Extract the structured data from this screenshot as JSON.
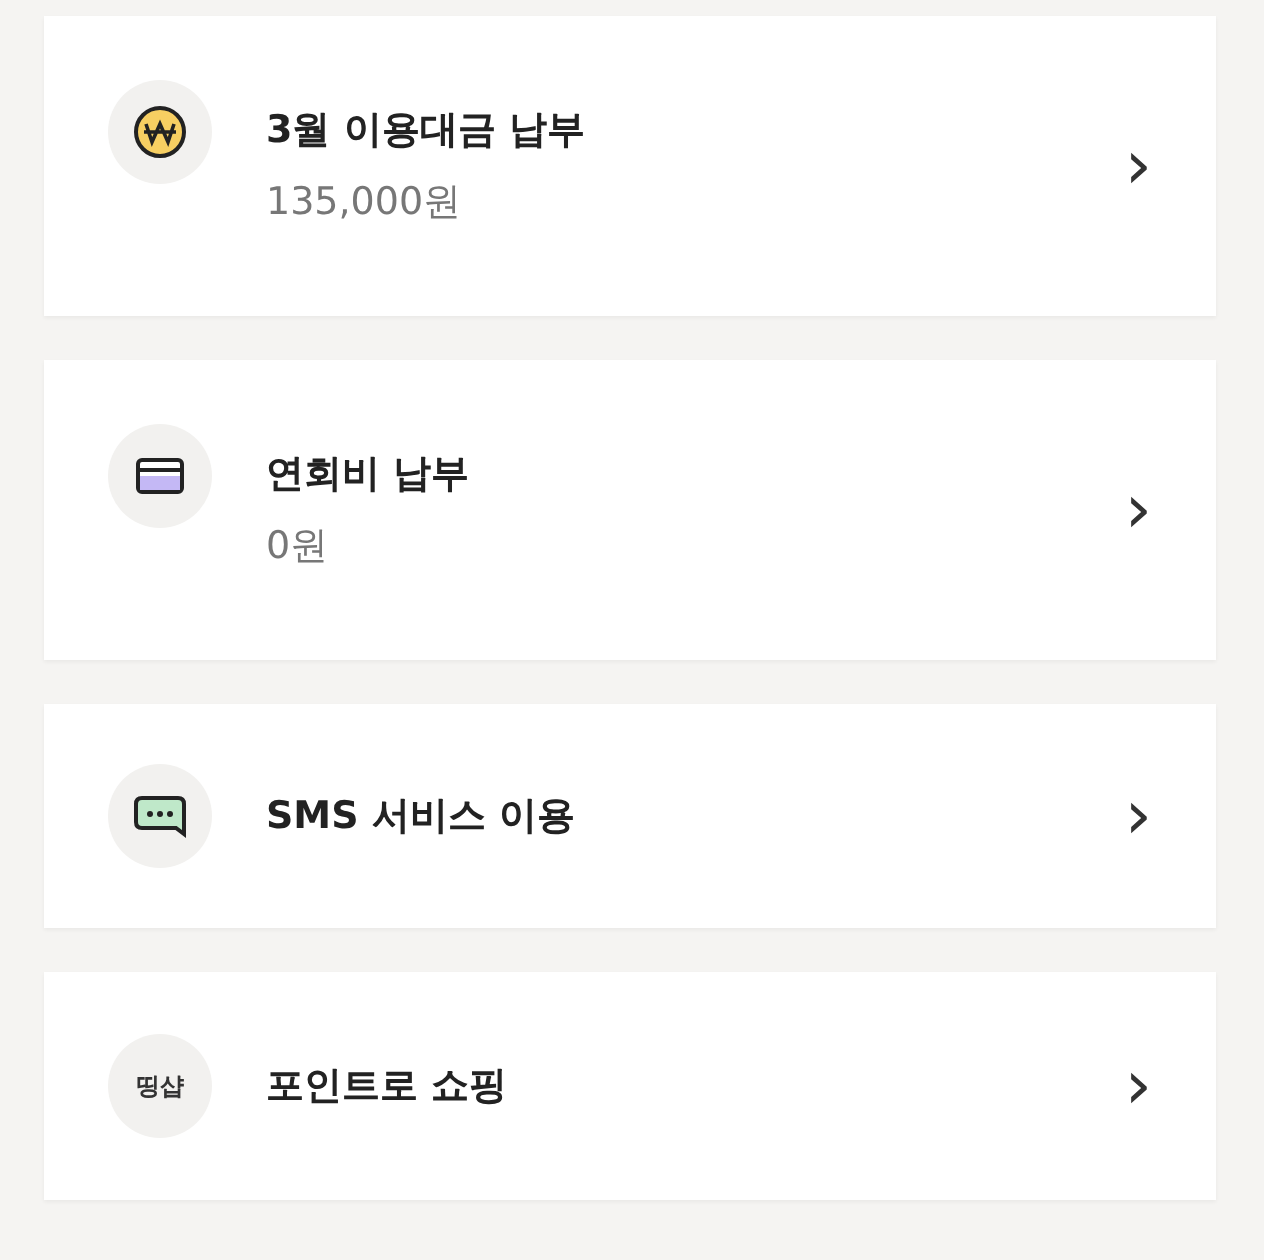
{
  "items": [
    {
      "kind": "won",
      "title": "3월 이용대금 납부",
      "subtitle": "135,000원",
      "chevron": "›"
    },
    {
      "kind": "card",
      "title": "연회비 납부",
      "subtitle": "0원",
      "chevron": "›"
    },
    {
      "kind": "chat",
      "title": "SMS 서비스 이용",
      "chevron": "›"
    },
    {
      "kind": "logo",
      "logo_text": "띵샵",
      "title": "포인트로 쇼핑",
      "chevron": "›"
    }
  ]
}
